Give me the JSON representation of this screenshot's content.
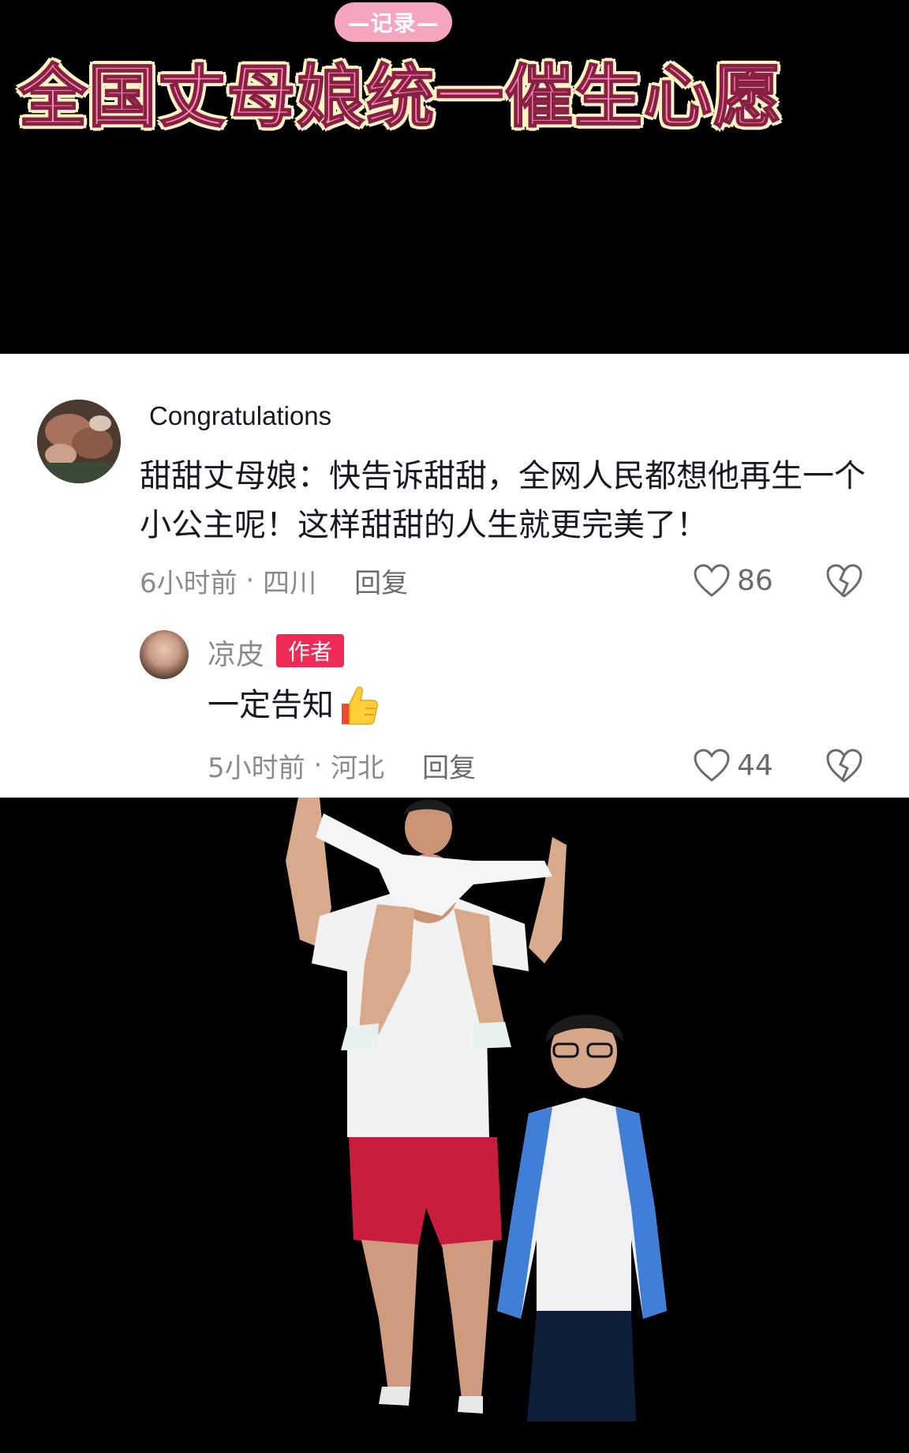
{
  "header": {
    "tag": "—记录—",
    "title": "全国丈母娘统一催生心愿"
  },
  "comment": {
    "username": "Congratulations",
    "text": "甜甜丈母娘：快告诉甜甜，全网人民都想他再生一个小公主呢！这样甜甜的人生就更完美了！",
    "time": "6小时前",
    "location": "四川",
    "reply_label": "回复",
    "likes": "86"
  },
  "reply": {
    "username": "凉皮",
    "badge": "作者",
    "text": "一定告知",
    "time": "5小时前",
    "location": "河北",
    "reply_label": "回复",
    "likes": "44"
  },
  "icons": {
    "like": "heart-outline-icon",
    "dislike": "broken-heart-icon",
    "emoji": "thumbs-up-emoji"
  },
  "colors": {
    "badge": "#ee2a55",
    "title_pink": "#f490b4",
    "tag_pink": "#f6a5c0"
  }
}
